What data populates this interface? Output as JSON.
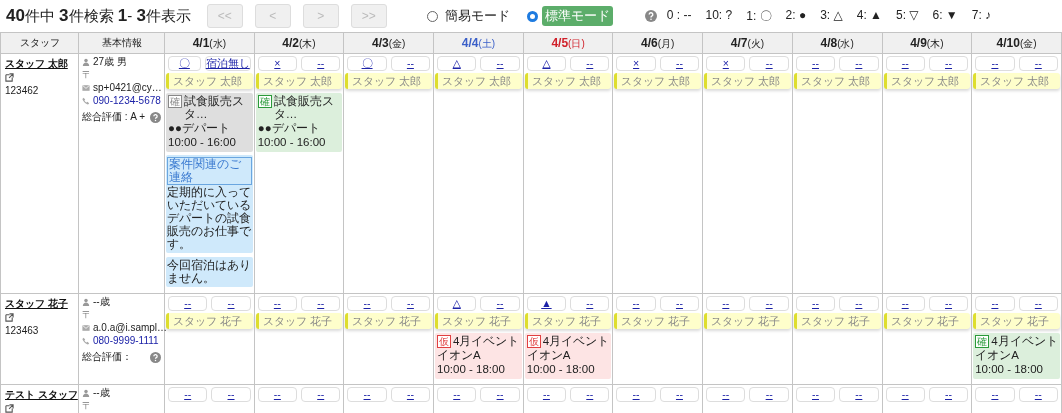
{
  "summary": "**40**件中 **3**件検索 **1**- **3**件表示",
  "pager": [
    {
      "label": "<<",
      "disabled": true
    },
    {
      "label": "<",
      "disabled": true
    },
    {
      "label": ">",
      "disabled": true
    },
    {
      "label": ">>",
      "disabled": true
    }
  ],
  "modes": [
    {
      "label": "簡易モード",
      "selected": false
    },
    {
      "label": "標準モード",
      "selected": true
    }
  ],
  "legend": [
    "0 : --",
    "10:  ?",
    "1: 〇",
    "2: ●",
    "3: △",
    "4: ▲",
    "5: ▽",
    "6: ▼",
    "7: ♪"
  ],
  "columns": [
    {
      "label": "スタッフ"
    },
    {
      "label": "基本情報"
    }
  ],
  "days": [
    {
      "date": "4/1",
      "weekday": "(水)",
      "kind": "weekday"
    },
    {
      "date": "4/2",
      "weekday": "(木)",
      "kind": "weekday"
    },
    {
      "date": "4/3",
      "weekday": "(金)",
      "kind": "weekday"
    },
    {
      "date": "4/4",
      "weekday": "(土)",
      "kind": "sat"
    },
    {
      "date": "4/5",
      "weekday": "(日)",
      "kind": "sun"
    },
    {
      "date": "4/6",
      "weekday": "(月)",
      "kind": "weekday"
    },
    {
      "date": "4/7",
      "weekday": "(火)",
      "kind": "weekday"
    },
    {
      "date": "4/8",
      "weekday": "(水)",
      "kind": "weekday"
    },
    {
      "date": "4/9",
      "weekday": "(木)",
      "kind": "weekday"
    },
    {
      "date": "4/10",
      "weekday": "(金)",
      "kind": "weekday"
    }
  ],
  "rows": [
    {
      "name": "スタッフ 太郎",
      "id": "123462",
      "age": "27歳 男",
      "postal": "〒",
      "email": "sp+0421@cy…",
      "phone": "090-1234-5678",
      "rating": "総合評価 : A +",
      "cells": [
        {
          "avail": "〇",
          "lodging": "宿泊無し",
          "card": "スタッフ 太郎",
          "jobs": [
            {
              "kind": "done",
              "tag": "確",
              "title": "試食販売スタ…",
              "place": "●●デパート",
              "time": "10:00 - 16:00"
            }
          ],
          "notes": [
            {
              "title": "案件関連のご連絡",
              "text": "定期的に入っていただいているデパートの試食販売のお仕事です。"
            },
            {
              "text": "今回宿泊はありません。"
            }
          ]
        },
        {
          "avail": "×",
          "lodging": "--",
          "card": "スタッフ 太郎",
          "jobs": [
            {
              "kind": "confirmed",
              "tag": "確",
              "title": "試食販売スタ…",
              "place": "●●デパート",
              "time": "10:00 - 16:00"
            }
          ]
        },
        {
          "avail": "〇",
          "lodging": "--",
          "card": "スタッフ 太郎"
        },
        {
          "avail": "△",
          "lodging": "--",
          "card": "スタッフ 太郎"
        },
        {
          "avail": "△",
          "lodging": "--",
          "card": "スタッフ 太郎"
        },
        {
          "avail": "×",
          "lodging": "--",
          "card": "スタッフ 太郎"
        },
        {
          "avail": "×",
          "lodging": "--",
          "card": "スタッフ 太郎"
        },
        {
          "avail": "--",
          "lodging": "--",
          "card": "スタッフ 太郎"
        },
        {
          "avail": "--",
          "lodging": "--",
          "card": "スタッフ 太郎"
        },
        {
          "avail": "--",
          "lodging": "--",
          "card": "スタッフ 太郎"
        }
      ]
    },
    {
      "name": "スタッフ 花子",
      "id": "123463",
      "age": "--歳",
      "postal": "〒",
      "email": "a.0.a@i.sampl…",
      "phone": "080-9999-1111",
      "rating": "総合評価：",
      "cells": [
        {
          "avail": "--",
          "lodging": "--",
          "card": "スタッフ 花子"
        },
        {
          "avail": "--",
          "lodging": "--",
          "card": "スタッフ 花子"
        },
        {
          "avail": "--",
          "lodging": "--",
          "card": "スタッフ 花子"
        },
        {
          "avail": "△",
          "lodging": "--",
          "card": "スタッフ 花子",
          "jobs": [
            {
              "kind": "tentative",
              "tag": "仮",
              "title": "4月イベント",
              "place": "イオンA",
              "time": "10:00 - 18:00"
            }
          ]
        },
        {
          "avail": "▲",
          "lodging": "--",
          "card": "スタッフ 花子",
          "jobs": [
            {
              "kind": "tentative",
              "tag": "仮",
              "title": "4月イベント",
              "place": "イオンA",
              "time": "10:00 - 18:00"
            }
          ]
        },
        {
          "avail": "--",
          "lodging": "--",
          "card": "スタッフ 花子"
        },
        {
          "avail": "--",
          "lodging": "--",
          "card": "スタッフ 花子"
        },
        {
          "avail": "--",
          "lodging": "--",
          "card": "スタッフ 花子"
        },
        {
          "avail": "--",
          "lodging": "--",
          "card": "スタッフ 花子"
        },
        {
          "avail": "--",
          "lodging": "--",
          "card": "スタッフ 花子",
          "jobs": [
            {
              "kind": "confirmed",
              "tag": "確",
              "title": "4月イベント",
              "place": "イオンA",
              "time": "10:00 - 18:00"
            }
          ]
        }
      ]
    },
    {
      "name": "テスト スタッフ",
      "age": "--歳",
      "postal": "〒",
      "cells": [
        {
          "avail": "--",
          "lodging": "--"
        },
        {
          "avail": "--",
          "lodging": "--"
        },
        {
          "avail": "--",
          "lodging": "--"
        },
        {
          "avail": "--",
          "lodging": "--"
        },
        {
          "avail": "--",
          "lodging": "--"
        },
        {
          "avail": "--",
          "lodging": "--"
        },
        {
          "avail": "--",
          "lodging": "--"
        },
        {
          "avail": "--",
          "lodging": "--"
        },
        {
          "avail": "--",
          "lodging": "--"
        },
        {
          "avail": "--",
          "lodging": "--"
        }
      ]
    }
  ]
}
